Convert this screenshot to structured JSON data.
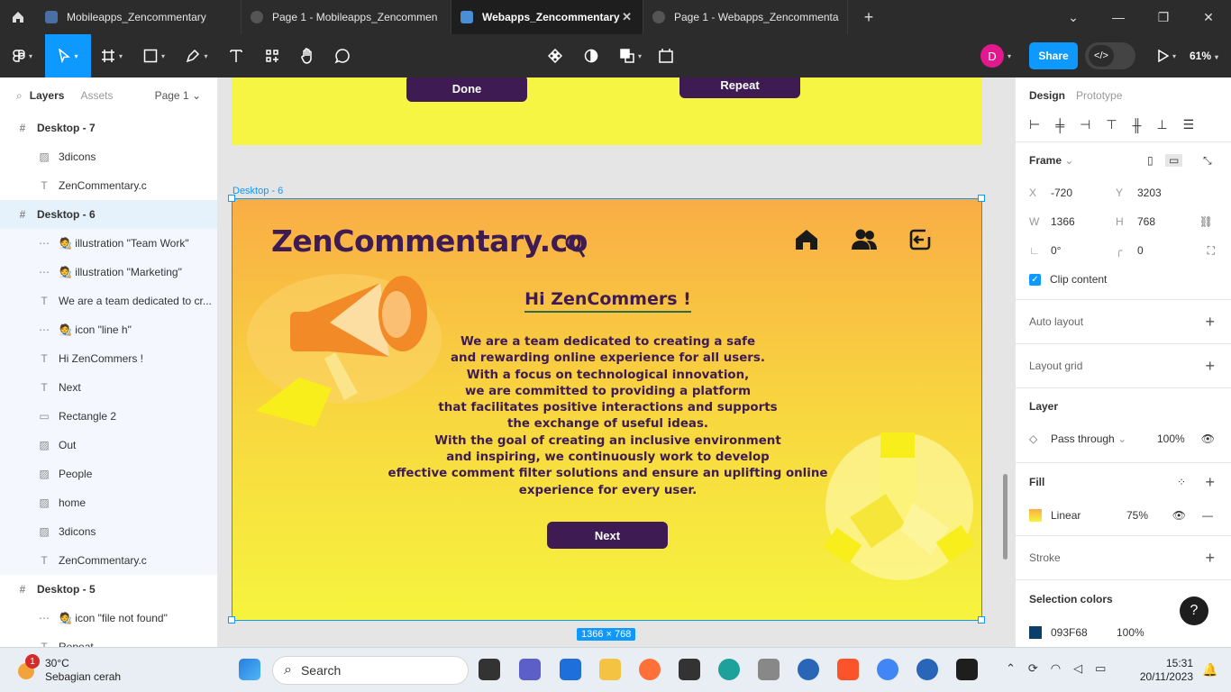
{
  "tabs": [
    {
      "label": "Mobileapps_Zencommentary",
      "active": false
    },
    {
      "label": "Page 1 - Mobileapps_Zencommen",
      "active": false
    },
    {
      "label": "Webapps_Zencommentary",
      "active": true
    },
    {
      "label": "Page 1 - Webapps_Zencommenta",
      "active": false
    }
  ],
  "toolbar": {
    "zoom": "61%",
    "share_label": "Share",
    "avatar_initial": "D"
  },
  "left_panel": {
    "tab_layers": "Layers",
    "tab_assets": "Assets",
    "page_selector": "Page 1",
    "layers": [
      {
        "label": "Desktop - 7",
        "kind": "frame"
      },
      {
        "label": "3dicons",
        "kind": "image"
      },
      {
        "label": "ZenCommentary.c",
        "kind": "text"
      },
      {
        "label": "Desktop - 6",
        "kind": "frame"
      },
      {
        "label": "🧑‍🎨 illustration \"Team Work\"",
        "kind": "group"
      },
      {
        "label": "🧑‍🎨 illustration \"Marketing\"",
        "kind": "group"
      },
      {
        "label": "We are a team dedicated to cr...",
        "kind": "text"
      },
      {
        "label": "🧑‍🎨 icon \"line h\"",
        "kind": "group"
      },
      {
        "label": "Hi ZenCommers !",
        "kind": "text"
      },
      {
        "label": "Next",
        "kind": "text"
      },
      {
        "label": "Rectangle 2",
        "kind": "rect"
      },
      {
        "label": "Out",
        "kind": "image"
      },
      {
        "label": "People",
        "kind": "image"
      },
      {
        "label": "home",
        "kind": "image"
      },
      {
        "label": "3dicons",
        "kind": "image"
      },
      {
        "label": "ZenCommentary.c",
        "kind": "text"
      },
      {
        "label": "Desktop - 5",
        "kind": "frame"
      },
      {
        "label": "🧑‍🎨 icon \"file not found\"",
        "kind": "group"
      },
      {
        "label": "Repeat",
        "kind": "text"
      }
    ]
  },
  "canvas": {
    "top_frame": {
      "done_label": "Done",
      "repeat_label": "Repeat"
    },
    "frame_label": "Desktop - 6",
    "size_badge": "1366 × 768",
    "design": {
      "logo": "ZenCommentary.co",
      "greeting": "Hi ZenCommers !",
      "paragraph_lines": [
        "We are a team dedicated to creating a safe",
        "and rewarding online experience for all users.",
        "With a focus on technological innovation,",
        "we are committed to providing a platform",
        "that facilitates positive interactions and supports",
        "the exchange of useful ideas.",
        "With the goal of creating an inclusive environment",
        "and inspiring, we continuously work to develop",
        "effective comment filter solutions and ensure an uplifting online",
        "experience for every user."
      ],
      "next_label": "Next"
    }
  },
  "right_panel": {
    "tab_design": "Design",
    "tab_prototype": "Prototype",
    "frame_title": "Frame",
    "x": "-720",
    "y": "3203",
    "w": "1366",
    "h": "768",
    "rotation": "0°",
    "radius": "0",
    "clip_content": "Clip content",
    "auto_layout": "Auto layout",
    "layout_grid": "Layout grid",
    "layer_title": "Layer",
    "blend_mode": "Pass through",
    "layer_opacity": "100%",
    "fill_title": "Fill",
    "fill_type": "Linear",
    "fill_opacity": "75%",
    "stroke_title": "Stroke",
    "selection_colors_title": "Selection colors",
    "selection_color_hex": "093F68",
    "selection_color_opacity": "100%"
  },
  "taskbar": {
    "temperature": "30°C",
    "weather": "Sebagian cerah",
    "weather_badge": "1",
    "search_placeholder": "Search",
    "time": "15:31",
    "date": "20/11/2023"
  },
  "colors": {
    "accent": "#0d99ff",
    "brand_purple": "#3e1b52",
    "selection_swatch": "#093F68"
  }
}
